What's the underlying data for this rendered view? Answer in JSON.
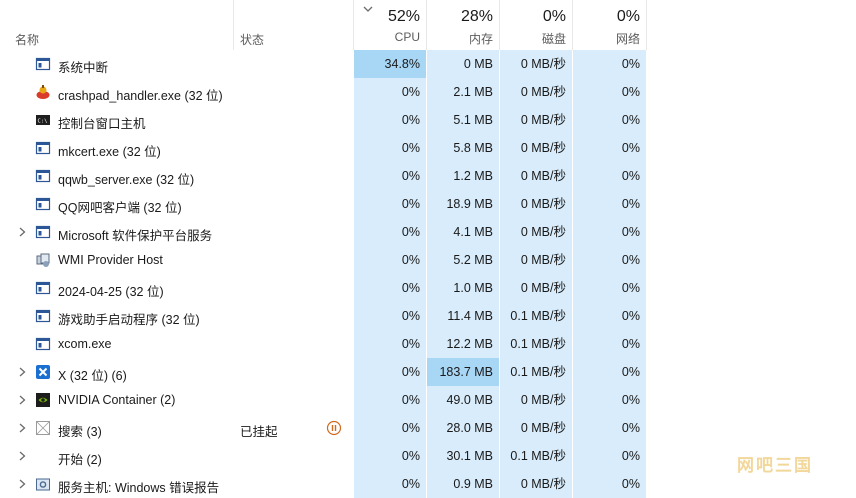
{
  "columns": {
    "name": "名称",
    "status": "状态",
    "cpu": {
      "pct": "52%",
      "label": "CPU"
    },
    "memory": {
      "pct": "28%",
      "label": "内存"
    },
    "disk": {
      "pct": "0%",
      "label": "磁盘"
    },
    "network": {
      "pct": "0%",
      "label": "网络"
    }
  },
  "colors": {
    "heat_light": "#d8ecfb",
    "heat_mid": "#c5e4f8",
    "heat_strong": "#a8d6f5",
    "header_bg": "#ffffff"
  },
  "processes": [
    {
      "name": "系统中断",
      "icon": "window-icon",
      "expandable": false,
      "status": "",
      "cpu": "34.8%",
      "mem": "0 MB",
      "disk": "0 MB/秒",
      "net": "0%",
      "cpu_heat": "strong",
      "mem_heat": "light"
    },
    {
      "name": "crashpad_handler.exe (32 位)",
      "icon": "crashpad-icon",
      "expandable": false,
      "status": "",
      "cpu": "0%",
      "mem": "2.1 MB",
      "disk": "0 MB/秒",
      "net": "0%",
      "cpu_heat": "light",
      "mem_heat": "light"
    },
    {
      "name": "控制台窗口主机",
      "icon": "console-icon",
      "expandable": false,
      "status": "",
      "cpu": "0%",
      "mem": "5.1 MB",
      "disk": "0 MB/秒",
      "net": "0%",
      "cpu_heat": "light",
      "mem_heat": "light"
    },
    {
      "name": "mkcert.exe (32 位)",
      "icon": "window-icon",
      "expandable": false,
      "status": "",
      "cpu": "0%",
      "mem": "5.8 MB",
      "disk": "0 MB/秒",
      "net": "0%",
      "cpu_heat": "light",
      "mem_heat": "light"
    },
    {
      "name": "qqwb_server.exe (32 位)",
      "icon": "window-icon",
      "expandable": false,
      "status": "",
      "cpu": "0%",
      "mem": "1.2 MB",
      "disk": "0 MB/秒",
      "net": "0%",
      "cpu_heat": "light",
      "mem_heat": "light"
    },
    {
      "name": "QQ网吧客户端 (32 位)",
      "icon": "window-icon",
      "expandable": false,
      "status": "",
      "cpu": "0%",
      "mem": "18.9 MB",
      "disk": "0 MB/秒",
      "net": "0%",
      "cpu_heat": "light",
      "mem_heat": "light"
    },
    {
      "name": "Microsoft 软件保护平台服务",
      "icon": "window-icon",
      "expandable": true,
      "status": "",
      "cpu": "0%",
      "mem": "4.1 MB",
      "disk": "0 MB/秒",
      "net": "0%",
      "cpu_heat": "light",
      "mem_heat": "light"
    },
    {
      "name": "WMI Provider Host",
      "icon": "wmi-icon",
      "expandable": false,
      "status": "",
      "cpu": "0%",
      "mem": "5.2 MB",
      "disk": "0 MB/秒",
      "net": "0%",
      "cpu_heat": "light",
      "mem_heat": "light"
    },
    {
      "name": "2024-04-25 (32 位)",
      "icon": "window-icon",
      "expandable": false,
      "status": "",
      "cpu": "0%",
      "mem": "1.0 MB",
      "disk": "0 MB/秒",
      "net": "0%",
      "cpu_heat": "light",
      "mem_heat": "light"
    },
    {
      "name": "游戏助手启动程序 (32 位)",
      "icon": "window-icon",
      "expandable": false,
      "status": "",
      "cpu": "0%",
      "mem": "11.4 MB",
      "disk": "0.1 MB/秒",
      "net": "0%",
      "cpu_heat": "light",
      "mem_heat": "light"
    },
    {
      "name": "xcom.exe",
      "icon": "window-icon",
      "expandable": false,
      "status": "",
      "cpu": "0%",
      "mem": "12.2 MB",
      "disk": "0.1 MB/秒",
      "net": "0%",
      "cpu_heat": "light",
      "mem_heat": "light"
    },
    {
      "name": "X (32 位) (6)",
      "icon": "x-app-icon",
      "expandable": true,
      "status": "",
      "cpu": "0%",
      "mem": "183.7 MB",
      "disk": "0.1 MB/秒",
      "net": "0%",
      "cpu_heat": "light",
      "mem_heat": "strong"
    },
    {
      "name": "NVIDIA Container (2)",
      "icon": "nvidia-icon",
      "expandable": true,
      "status": "",
      "cpu": "0%",
      "mem": "49.0 MB",
      "disk": "0 MB/秒",
      "net": "0%",
      "cpu_heat": "light",
      "mem_heat": "light"
    },
    {
      "name": "搜索 (3)",
      "icon": "search-app-icon",
      "expandable": true,
      "status": "已挂起",
      "cpu": "0%",
      "mem": "28.0 MB",
      "disk": "0 MB/秒",
      "net": "0%",
      "cpu_heat": "light",
      "mem_heat": "light"
    },
    {
      "name": "开始 (2)",
      "icon": "blank-icon",
      "expandable": true,
      "status": "",
      "cpu": "0%",
      "mem": "30.1 MB",
      "disk": "0.1 MB/秒",
      "net": "0%",
      "cpu_heat": "light",
      "mem_heat": "light"
    },
    {
      "name": "服务主机: Windows 错误报告",
      "icon": "service-icon",
      "expandable": true,
      "status": "",
      "cpu": "0%",
      "mem": "0.9 MB",
      "disk": "0 MB/秒",
      "net": "0%",
      "cpu_heat": "light",
      "mem_heat": "light"
    }
  ],
  "watermark": "网吧三国"
}
